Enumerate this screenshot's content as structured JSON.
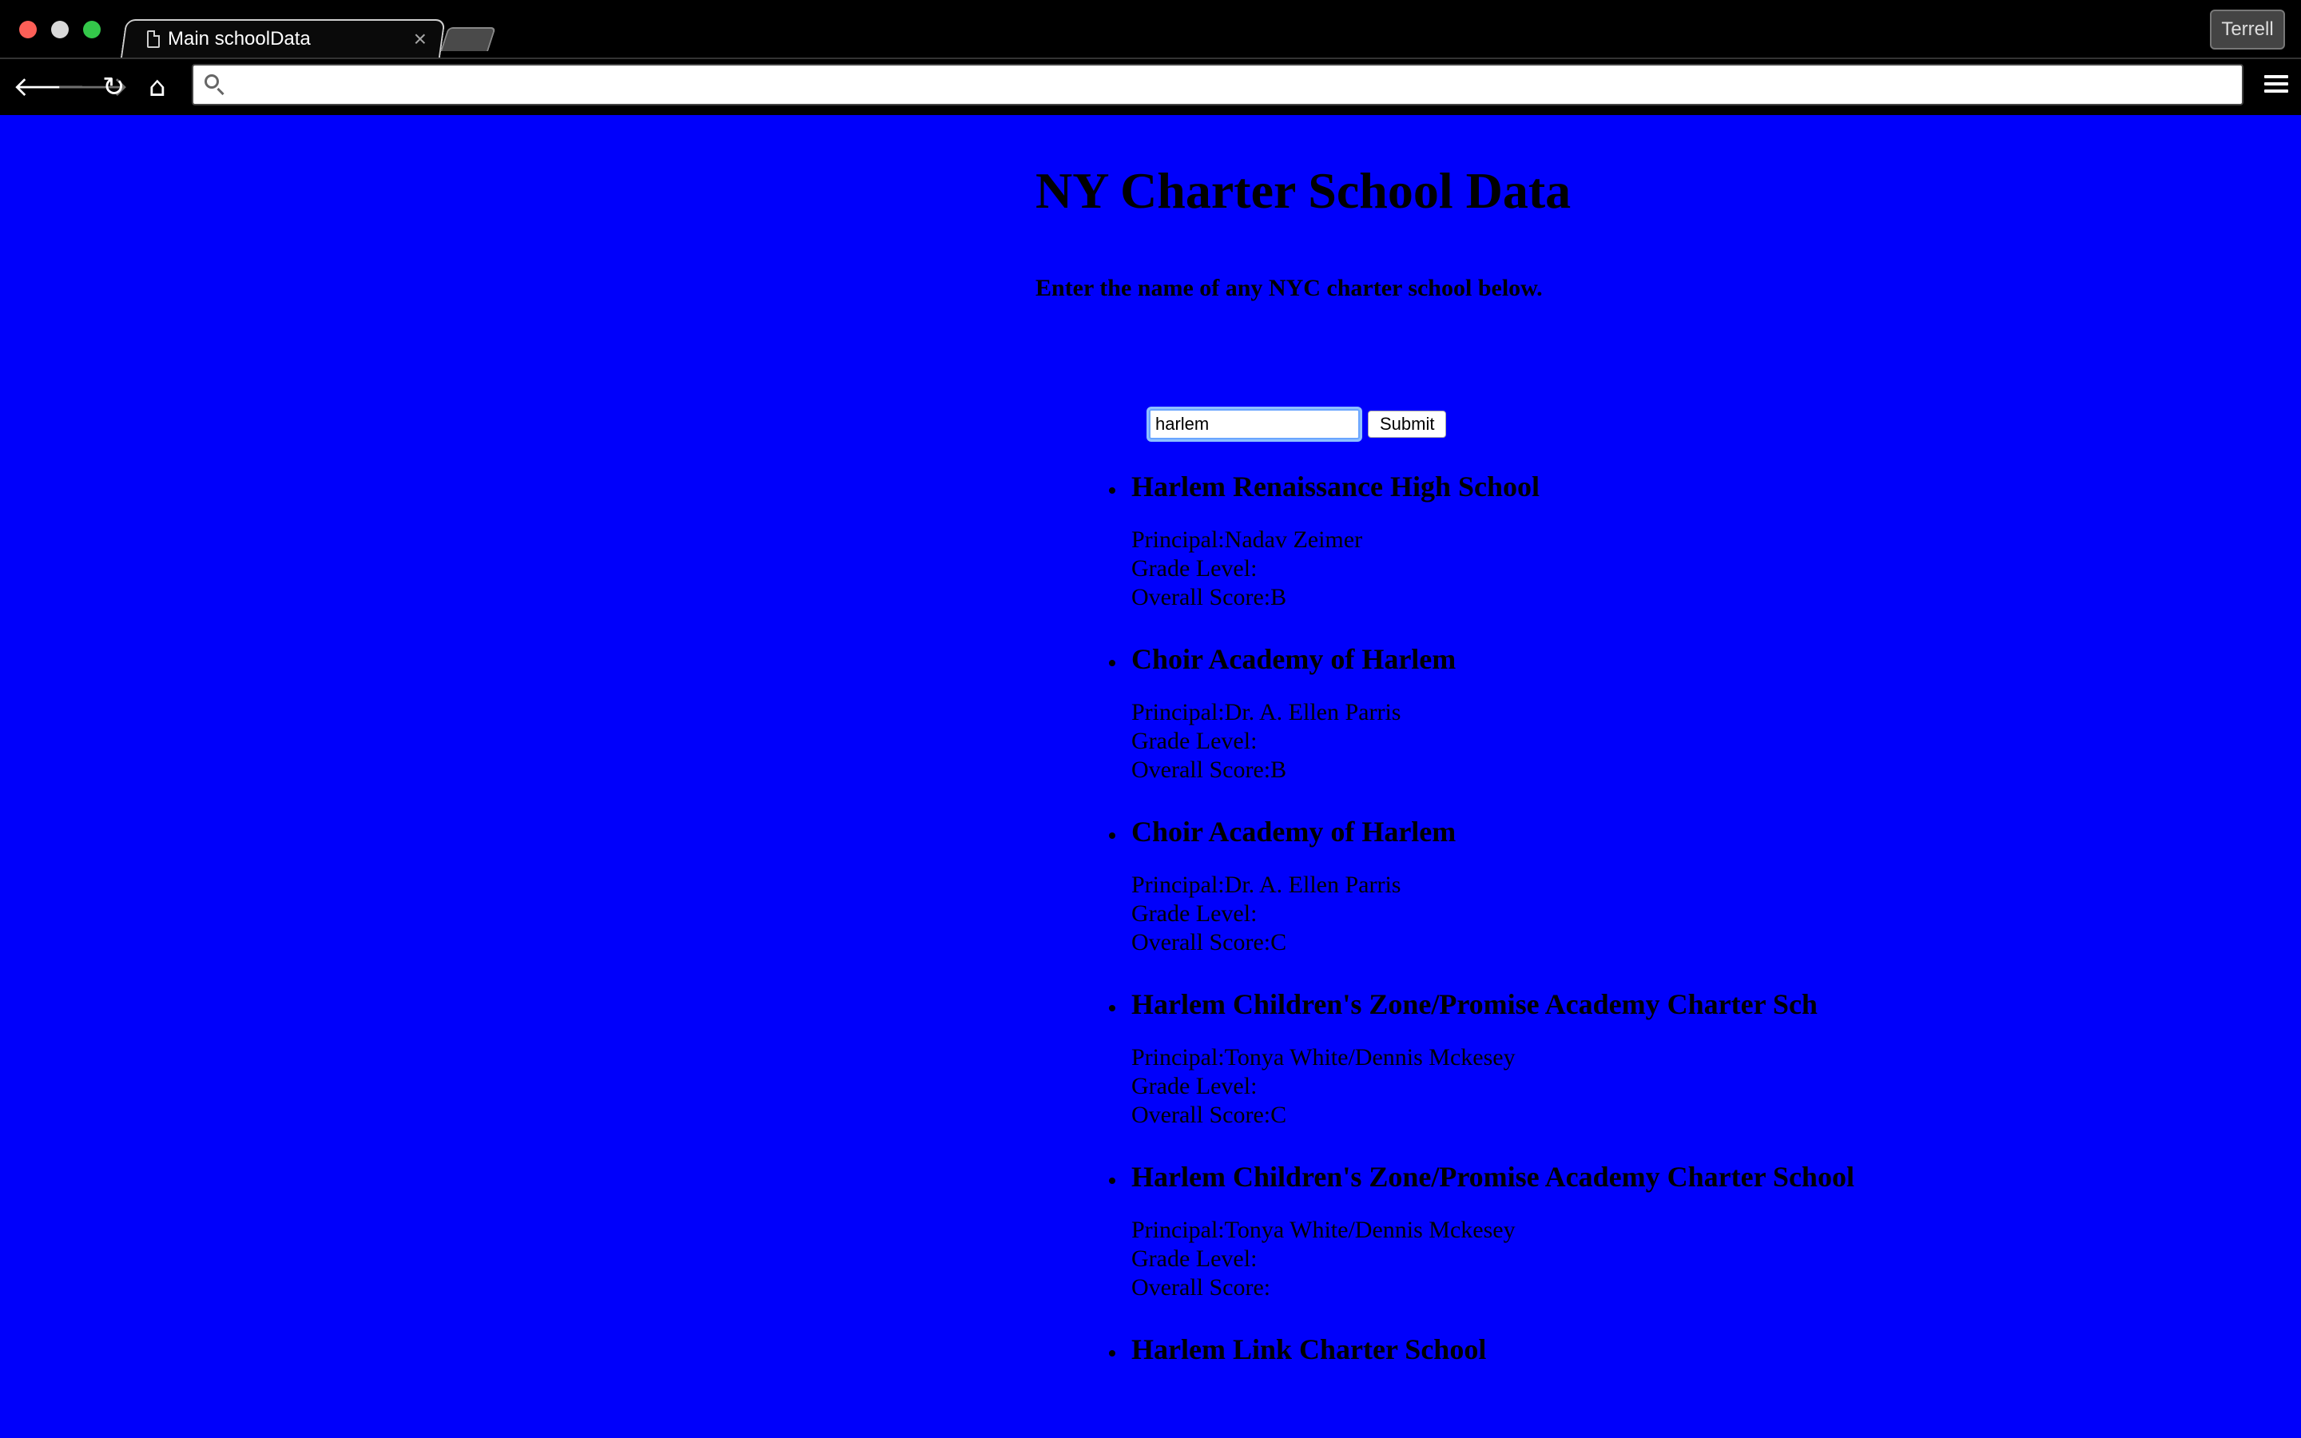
{
  "browser": {
    "tab_title": "Main schoolData",
    "tab_close": "×",
    "profile_label": "Terrell",
    "url": ""
  },
  "page": {
    "title": "NY Charter School Data",
    "instructions": "Enter the name of any NYC charter school below.",
    "search": {
      "value": "harlem",
      "submit_label": "Submit"
    }
  },
  "labels": {
    "principal": "Principal:",
    "grade_level": "Grade Level:",
    "overall_score": "Overall Score:"
  },
  "results": [
    {
      "name": "Harlem Renaissance High School",
      "principal": "Nadav Zeimer",
      "grade_level": "",
      "overall_score": "B"
    },
    {
      "name": "Choir Academy of Harlem",
      "principal": "Dr. A. Ellen Parris",
      "grade_level": "",
      "overall_score": "B"
    },
    {
      "name": "Choir Academy of Harlem",
      "principal": "Dr. A. Ellen Parris",
      "grade_level": "",
      "overall_score": "C"
    },
    {
      "name": "Harlem Children's Zone/Promise Academy Charter Sch",
      "principal": "Tonya White/Dennis Mckesey",
      "grade_level": "",
      "overall_score": "C"
    },
    {
      "name": "Harlem Children's Zone/Promise Academy Charter School",
      "principal": "Tonya White/Dennis Mckesey",
      "grade_level": "",
      "overall_score": ""
    },
    {
      "name": "Harlem Link Charter School"
    }
  ]
}
